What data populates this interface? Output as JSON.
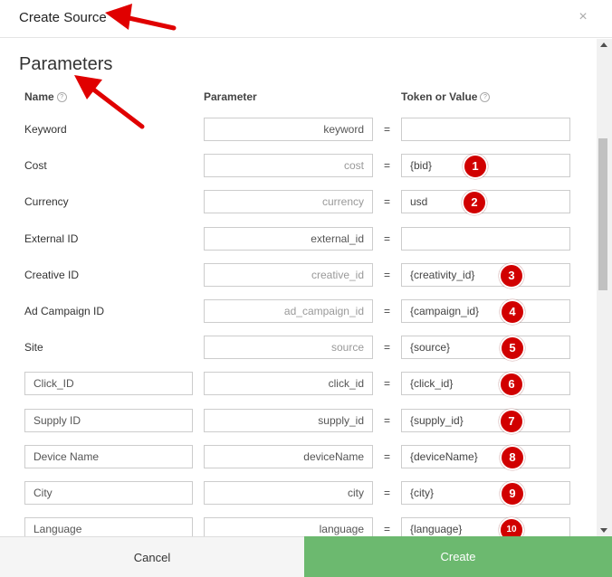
{
  "header": {
    "title": "Create Source",
    "close_label": "×"
  },
  "section": {
    "title": "Parameters"
  },
  "columns": {
    "name": "Name",
    "parameter": "Parameter",
    "token": "Token or Value",
    "help": "?"
  },
  "equals": "=",
  "rows": [
    {
      "name": "Keyword",
      "parameter": "keyword",
      "token": "",
      "badge": ""
    },
    {
      "name": "Cost",
      "parameter": "cost",
      "token": "{bid}",
      "badge": "1"
    },
    {
      "name": "Currency",
      "parameter": "currency",
      "token": "usd",
      "badge": "2"
    },
    {
      "name": "External ID",
      "parameter": "external_id",
      "token": "",
      "badge": ""
    },
    {
      "name": "Creative ID",
      "parameter": "creative_id",
      "token": "{creativity_id}",
      "badge": "3"
    },
    {
      "name": "Ad Campaign ID",
      "parameter": "ad_campaign_id",
      "token": "{campaign_id}",
      "badge": "4"
    },
    {
      "name": "Site",
      "parameter": "source",
      "token": "{source}",
      "badge": "5"
    },
    {
      "name": "Click_ID",
      "parameter": "click_id",
      "token": "{click_id}",
      "badge": "6"
    },
    {
      "name": "Supply ID",
      "parameter": "supply_id",
      "token": "{supply_id}",
      "badge": "7"
    },
    {
      "name": "Device Name",
      "parameter": "deviceName",
      "token": "{deviceName}",
      "badge": "8"
    },
    {
      "name": "City",
      "parameter": "city",
      "token": "{city}",
      "badge": "9"
    },
    {
      "name": "Language",
      "parameter": "language",
      "token": "{language}",
      "badge": "10"
    }
  ],
  "footer": {
    "cancel": "Cancel",
    "create": "Create"
  },
  "colors": {
    "badge": "#d10000",
    "create": "#6cb96f",
    "arrow": "#e00000"
  }
}
